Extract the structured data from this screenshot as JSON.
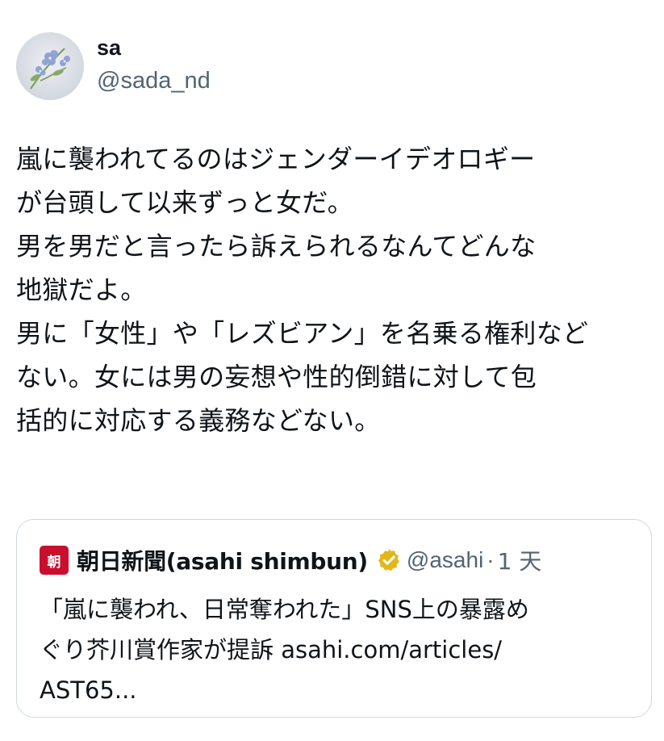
{
  "tweet": {
    "author": {
      "display_name": "sa",
      "handle": "@sada_nd",
      "avatar_icon": "flower-photo-avatar"
    },
    "text_lines": [
      "嵐に襲われてるのはジェンダーイデオロギー",
      "が台頭して以来ずっと女だ。",
      "男を男だと言ったら訴えられるなんてどんな",
      "地獄だよ。",
      "男に「女性」や「レズビアン」を名乗る権利など",
      "ない。女には男の妄想や性的倒錯に対して包",
      "括的に対応する義務などない。"
    ]
  },
  "quote": {
    "logo_text": "朝",
    "logo_color": "#c8102e",
    "display_name": "朝日新聞(asahi shimbun)",
    "verified_icon": "gold-verified-badge-icon",
    "verified_color": "#e2b719",
    "handle": "@asahi",
    "separator": "·",
    "time": "1 天",
    "text_lines": [
      "「嵐に襲われ、日常奪われた」SNS上の暴露め",
      "ぐり芥川賞作家が提訴 asahi.com/articles/",
      "AST65..."
    ]
  },
  "colors": {
    "text_primary": "#0f1419",
    "text_secondary": "#536471",
    "border": "#cfd9de"
  }
}
